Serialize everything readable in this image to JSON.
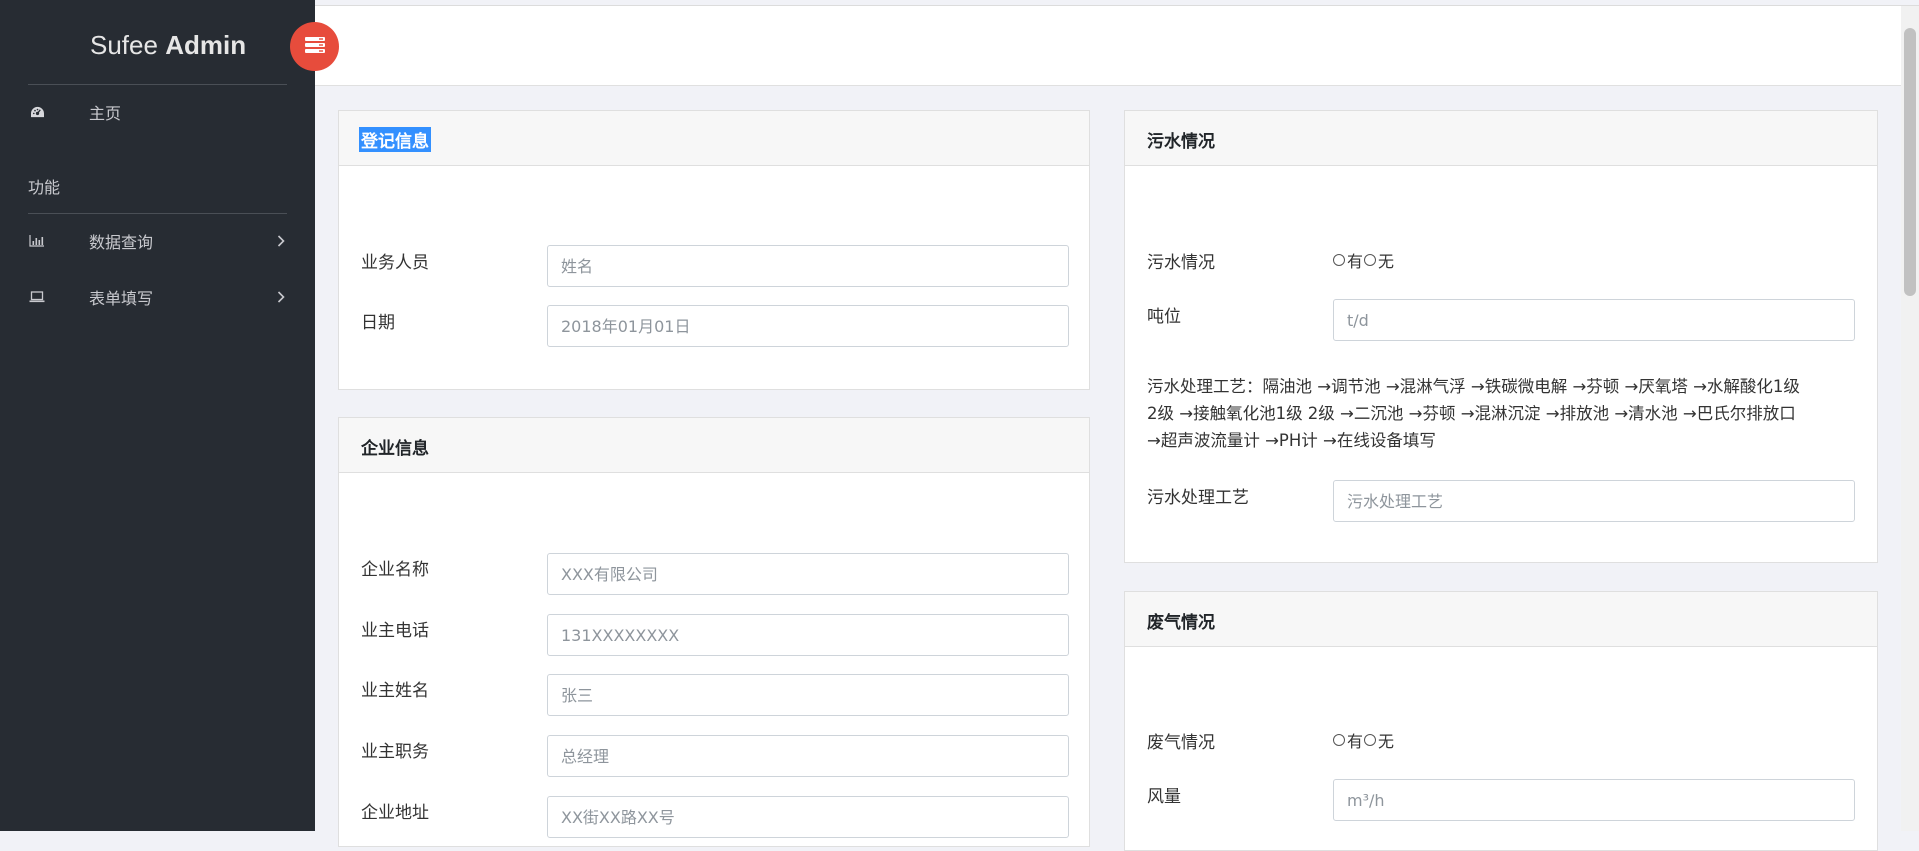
{
  "sidebar": {
    "brand_light": "Sufee",
    "brand_bold": "Admin",
    "home_label": "主页",
    "section_title": "功能",
    "items": [
      {
        "label": "数据查询",
        "icon": "bar-chart-icon"
      },
      {
        "label": "表单填写",
        "icon": "laptop-icon"
      }
    ]
  },
  "registration": {
    "title": "登记信息",
    "fields": [
      {
        "label": "业务人员",
        "placeholder": "姓名"
      },
      {
        "label": "日期",
        "placeholder": "2018年01月01日"
      }
    ]
  },
  "company": {
    "title": "企业信息",
    "fields": [
      {
        "label": "企业名称",
        "placeholder": "XXX有限公司"
      },
      {
        "label": "业主电话",
        "placeholder": "131XXXXXXXX"
      },
      {
        "label": "业主姓名",
        "placeholder": "张三"
      },
      {
        "label": "业主职务",
        "placeholder": "总经理"
      },
      {
        "label": "企业地址",
        "placeholder": "XX街XX路XX号"
      }
    ]
  },
  "sewage": {
    "title": "污水情况",
    "status_label": "污水情况",
    "option_yes": "有",
    "option_no": "无",
    "tonnage_label": "吨位",
    "tonnage_placeholder": "t/d",
    "process_line1": "污水处理工艺：隔油池 →调节池 →混淋气浮 →铁碳微电解 →芬顿 →厌氧塔 →水解酸化1级",
    "process_line2": "2级 →接触氧化池1级 2级 →二沉池 →芬顿 →混淋沉淀 →排放池 →清水池 →巴氏尔排放口",
    "process_line3": "→超声波流量计 →PH计 →在线设备填写",
    "process_label": "污水处理工艺",
    "process_placeholder": "污水处理工艺"
  },
  "exhaust": {
    "title": "废气情况",
    "status_label": "废气情况",
    "option_yes": "有",
    "option_no": "无",
    "airflow_label": "风量",
    "airflow_placeholder": "m³/h"
  }
}
